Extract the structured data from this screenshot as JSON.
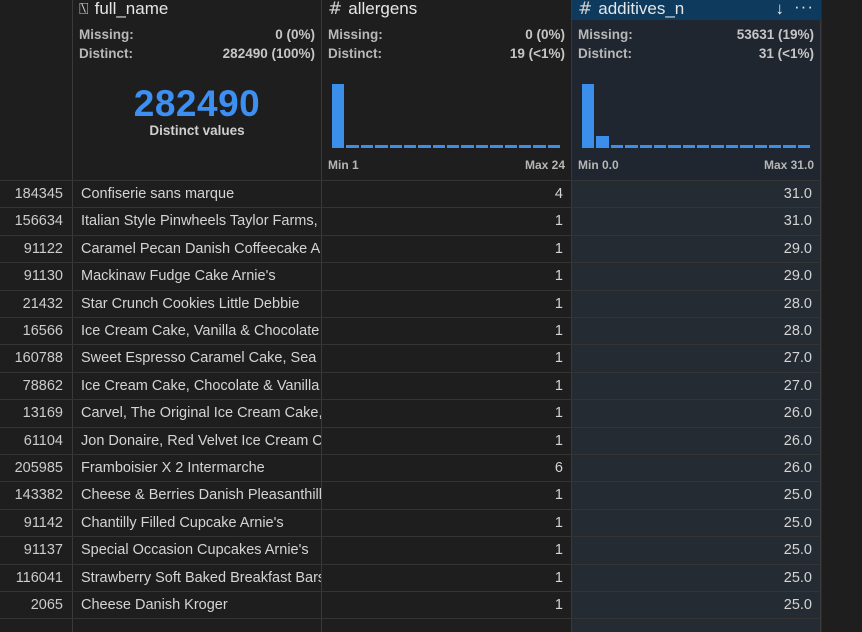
{
  "columns": {
    "full_name": {
      "title": "full_name",
      "icon": "text-column-icon",
      "missing_label": "Missing:",
      "missing": "0 (0%)",
      "distinct_label": "Distinct:",
      "distinct": "282490 (100%)",
      "distinct_big": "282490",
      "distinct_caption": "Distinct values"
    },
    "allergens": {
      "title": "allergens",
      "icon": "numeric-column-icon",
      "missing_label": "Missing:",
      "missing": "0 (0%)",
      "distinct_label": "Distinct:",
      "distinct": "19 (<1%)",
      "min_label": "Min 1",
      "max_label": "Max 24",
      "histogram": [
        1.0,
        0.05,
        0.05,
        0.05,
        0.05,
        0.05,
        0.05,
        0.05,
        0.05,
        0.05,
        0.05,
        0.05,
        0.05,
        0.05,
        0.05,
        0.05
      ]
    },
    "additives_n": {
      "title": "additives_n",
      "icon": "numeric-column-icon",
      "missing_label": "Missing:",
      "missing": "53631 (19%)",
      "distinct_label": "Distinct:",
      "distinct": "31 (<1%)",
      "min_label": "Min 0.0",
      "max_label": "Max 31.0",
      "histogram": [
        1.0,
        0.18,
        0.05,
        0.04,
        0.04,
        0.04,
        0.04,
        0.04,
        0.04,
        0.04,
        0.04,
        0.04,
        0.04,
        0.04,
        0.04,
        0.04
      ]
    }
  },
  "accent_color": "#3b8eea",
  "rows": [
    {
      "idx": "184345",
      "name": "Confiserie sans marque",
      "allergens": "4",
      "additives": "31.0"
    },
    {
      "idx": "156634",
      "name": "Italian Style Pinwheels Taylor Farms, T",
      "allergens": "1",
      "additives": "31.0"
    },
    {
      "idx": "91122",
      "name": "Caramel Pecan Danish Coffeecake Arn",
      "allergens": "1",
      "additives": "29.0"
    },
    {
      "idx": "91130",
      "name": "Mackinaw Fudge Cake Arnie's",
      "allergens": "1",
      "additives": "29.0"
    },
    {
      "idx": "21432",
      "name": "Star Crunch Cookies Little Debbie",
      "allergens": "1",
      "additives": "28.0"
    },
    {
      "idx": "16566",
      "name": "Ice Cream Cake, Vanilla & Chocolate",
      "allergens": "1",
      "additives": "28.0"
    },
    {
      "idx": "160788",
      "name": "Sweet Espresso Caramel Cake, Sea Sa",
      "allergens": "1",
      "additives": "27.0"
    },
    {
      "idx": "78862",
      "name": "Ice Cream Cake, Chocolate & Vanilla",
      "allergens": "1",
      "additives": "27.0"
    },
    {
      "idx": "13169",
      "name": "Carvel, The Original Ice Cream Cake,",
      "allergens": "1",
      "additives": "26.0"
    },
    {
      "idx": "61104",
      "name": "Jon Donaire, Red Velvet Ice Cream Ca",
      "allergens": "1",
      "additives": "26.0"
    },
    {
      "idx": "205985",
      "name": "Framboisier X 2 Intermarche",
      "allergens": "6",
      "additives": "26.0"
    },
    {
      "idx": "143382",
      "name": "Cheese & Berries Danish Pleasanthill",
      "allergens": "1",
      "additives": "25.0"
    },
    {
      "idx": "91142",
      "name": "Chantilly Filled Cupcake Arnie's",
      "allergens": "1",
      "additives": "25.0"
    },
    {
      "idx": "91137",
      "name": "Special Occasion Cupcakes Arnie's",
      "allergens": "1",
      "additives": "25.0"
    },
    {
      "idx": "116041",
      "name": "Strawberry Soft Baked Breakfast Bars",
      "allergens": "1",
      "additives": "25.0"
    },
    {
      "idx": "2065",
      "name": "Cheese Danish Kroger",
      "allergens": "1",
      "additives": "25.0"
    },
    {
      "idx": "",
      "name": "",
      "allergens": "",
      "additives": ""
    }
  ]
}
